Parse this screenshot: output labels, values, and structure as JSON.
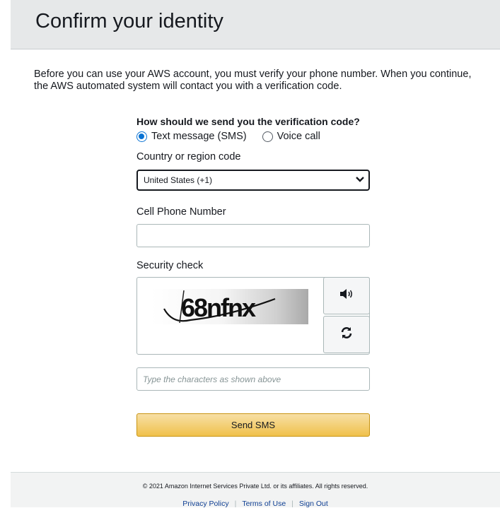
{
  "header": {
    "title": "Confirm your identity"
  },
  "intro": "Before you can use your AWS account, you must verify your phone number. When you continue, the AWS automated system will contact you with a verification code.",
  "method": {
    "question": "How should we send you the verification code?",
    "options": [
      {
        "label": "Text message (SMS)",
        "selected": true
      },
      {
        "label": "Voice call",
        "selected": false
      }
    ]
  },
  "country": {
    "label": "Country or region code",
    "selected": "United States (+1)"
  },
  "phone": {
    "label": "Cell Phone Number",
    "value": ""
  },
  "security": {
    "label": "Security check",
    "captcha_text": "68nfnx",
    "input_placeholder": "Type the characters as shown above"
  },
  "submit_label": "Send SMS",
  "footer": {
    "copyright": "© 2021 Amazon Internet Services Private Ltd. or its affiliates. All rights reserved.",
    "links": [
      "Privacy Policy",
      "Terms of Use",
      "Sign Out"
    ]
  },
  "icons": {
    "audio": "speaker-icon",
    "refresh": "refresh-icon",
    "dropdown": "chevron-down-icon"
  },
  "colors": {
    "accent": "#0972d3",
    "button": "#f0c14b",
    "link": "#0f3f93"
  }
}
